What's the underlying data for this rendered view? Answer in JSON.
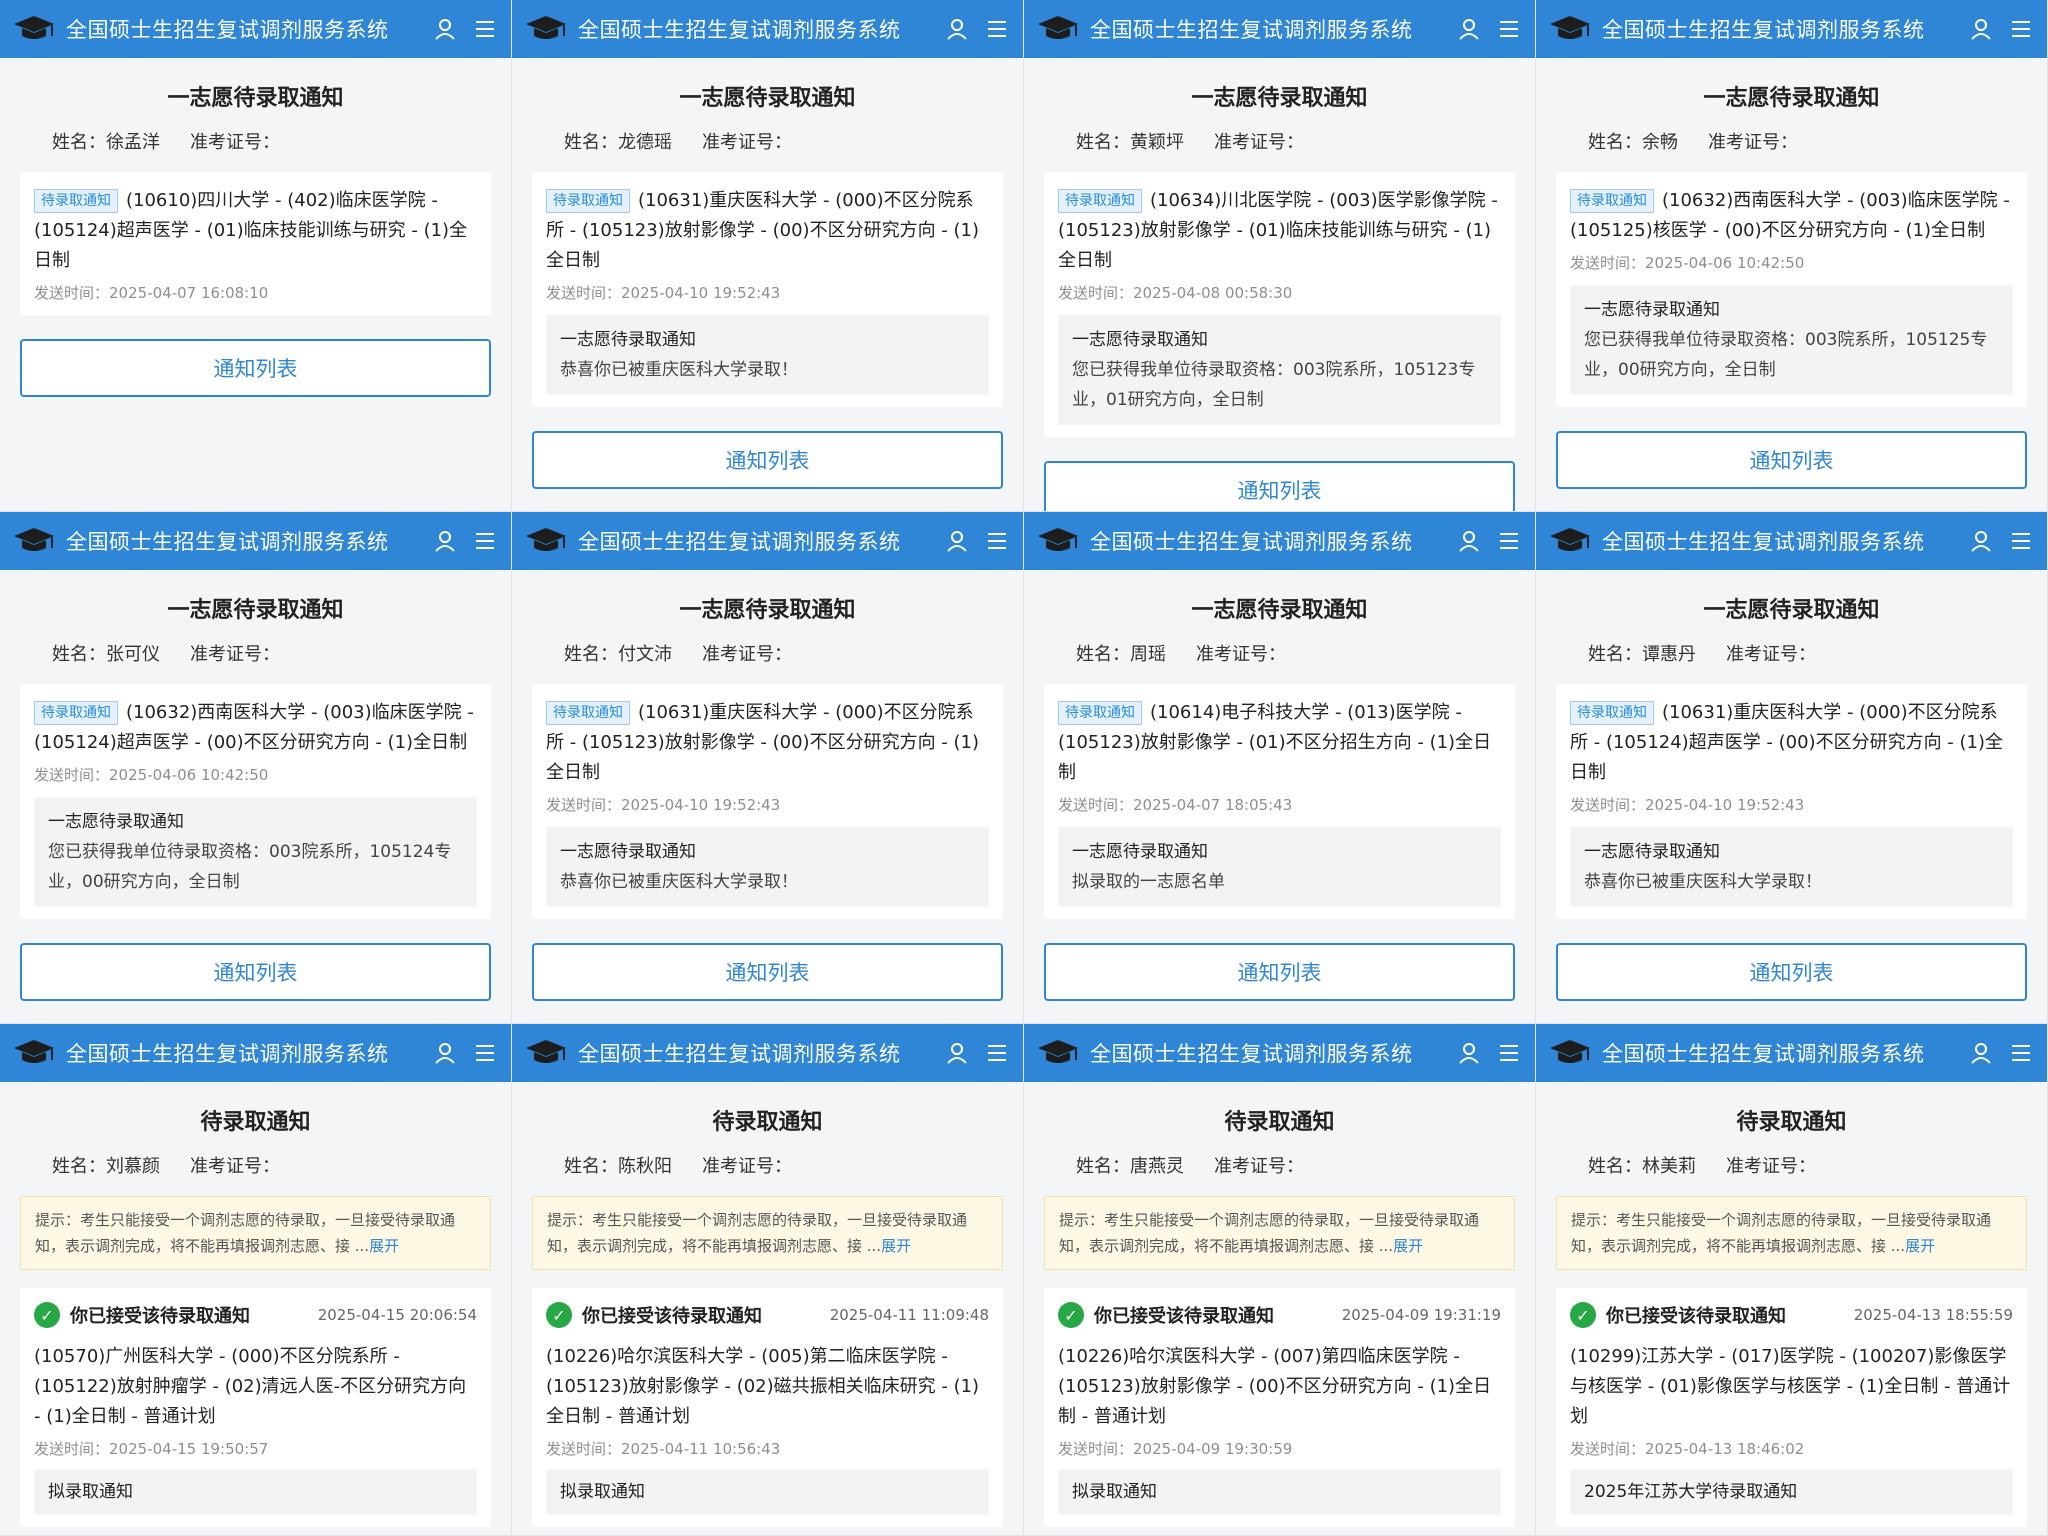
{
  "app_title": "全国硕士生招生复试调剂服务系统",
  "name_label": "姓名：",
  "exam_label": "准考证号：",
  "send_label": "发送时间：",
  "list_button": "通知列表",
  "tag_first": "待录取通知",
  "tip_text": "提示：考生只能接受一个调剂志愿的待录取，一旦接受待录取通知，表示调剂完成，将不能再填报调剂志愿、接 ...",
  "tip_expand": "展开",
  "accepted_label": "你已接受该待录取通知",
  "colors": {
    "topbar": "#2f86d6",
    "tag_bg": "#e4f1fc",
    "check": "#28a745"
  },
  "icons": [
    "graduation-cap-icon",
    "user-icon",
    "menu-icon",
    "check-icon"
  ],
  "panels": [
    {
      "kind": "first",
      "title": "一志愿待录取通知",
      "student": "徐孟洋",
      "content": "(10610)四川大学 - (402)临床医学院 - (105124)超声医学 - (01)临床技能训练与研究 - (1)全日制",
      "time": "2025-04-07 16:08:10"
    },
    {
      "kind": "first",
      "title": "一志愿待录取通知",
      "student": "龙德瑶",
      "content": "(10631)重庆医科大学 - (000)不区分院系所 - (105123)放射影像学 - (00)不区分研究方向 - (1)全日制",
      "time": "2025-04-10 19:52:43",
      "sub_title": "一志愿待录取通知",
      "sub_body": "恭喜你已被重庆医科大学录取！"
    },
    {
      "kind": "first",
      "title": "一志愿待录取通知",
      "student": "黄颖坪",
      "content": "(10634)川北医学院 - (003)医学影像学院 - (105123)放射影像学 - (01)临床技能训练与研究 - (1)全日制",
      "time": "2025-04-08 00:58:30",
      "sub_title": "一志愿待录取通知",
      "sub_body": "您已获得我单位待录取资格：003院系所，105123专业，01研究方向，全日制"
    },
    {
      "kind": "first",
      "title": "一志愿待录取通知",
      "student": "余畅",
      "content": "(10632)西南医科大学 - (003)临床医学院 - (105125)核医学 - (00)不区分研究方向 - (1)全日制",
      "time": "2025-04-06 10:42:50",
      "sub_title": "一志愿待录取通知",
      "sub_body": "您已获得我单位待录取资格：003院系所，105125专业，00研究方向，全日制"
    },
    {
      "kind": "first",
      "title": "一志愿待录取通知",
      "student": "张可仪",
      "content": "(10632)西南医科大学 - (003)临床医学院 - (105124)超声医学 - (00)不区分研究方向 - (1)全日制",
      "time": "2025-04-06 10:42:50",
      "sub_title": "一志愿待录取通知",
      "sub_body": "您已获得我单位待录取资格：003院系所，105124专业，00研究方向，全日制"
    },
    {
      "kind": "first",
      "title": "一志愿待录取通知",
      "student": "付文沛",
      "content": "(10631)重庆医科大学 - (000)不区分院系所 - (105123)放射影像学 - (00)不区分研究方向 - (1)全日制",
      "time": "2025-04-10 19:52:43",
      "sub_title": "一志愿待录取通知",
      "sub_body": "恭喜你已被重庆医科大学录取！"
    },
    {
      "kind": "first",
      "title": "一志愿待录取通知",
      "student": "周瑶",
      "content": "(10614)电子科技大学 - (013)医学院 - (105123)放射影像学 - (01)不区分招生方向 - (1)全日制",
      "time": "2025-04-07 18:05:43",
      "sub_title": "一志愿待录取通知",
      "sub_body": "拟录取的一志愿名单"
    },
    {
      "kind": "first",
      "title": "一志愿待录取通知",
      "student": "谭惠丹",
      "content": "(10631)重庆医科大学 - (000)不区分院系所 - (105124)超声医学 - (00)不区分研究方向 - (1)全日制",
      "time": "2025-04-10 19:52:43",
      "sub_title": "一志愿待录取通知",
      "sub_body": "恭喜你已被重庆医科大学录取！"
    },
    {
      "kind": "adjust",
      "title": "待录取通知",
      "student": "刘慕颜",
      "accepted_time": "2025-04-15 20:06:54",
      "content": "(10570)广州医科大学 - (000)不区分院系所 - (105122)放射肿瘤学 - (02)清远人医-不区分研究方向 - (1)全日制 - 普通计划",
      "time": "2025-04-15 19:50:57",
      "bottom": "拟录取通知"
    },
    {
      "kind": "adjust",
      "title": "待录取通知",
      "student": "陈秋阳",
      "accepted_time": "2025-04-11 11:09:48",
      "content": "(10226)哈尔滨医科大学 - (005)第二临床医学院 - (105123)放射影像学 - (02)磁共振相关临床研究 - (1)全日制 - 普通计划",
      "time": "2025-04-11 10:56:43",
      "bottom": "拟录取通知"
    },
    {
      "kind": "adjust",
      "title": "待录取通知",
      "student": "唐燕灵",
      "accepted_time": "2025-04-09 19:31:19",
      "content": "(10226)哈尔滨医科大学 - (007)第四临床医学院 - (105123)放射影像学 - (00)不区分研究方向 - (1)全日制 - 普通计划",
      "time": "2025-04-09 19:30:59",
      "bottom": "拟录取通知"
    },
    {
      "kind": "adjust",
      "title": "待录取通知",
      "student": "林美莉",
      "accepted_time": "2025-04-13 18:55:59",
      "content": "(10299)江苏大学 - (017)医学院 - (100207)影像医学与核医学 - (01)影像医学与核医学 - (1)全日制 - 普通计划",
      "time": "2025-04-13 18:46:02",
      "bottom": "2025年江苏大学待录取通知"
    }
  ]
}
